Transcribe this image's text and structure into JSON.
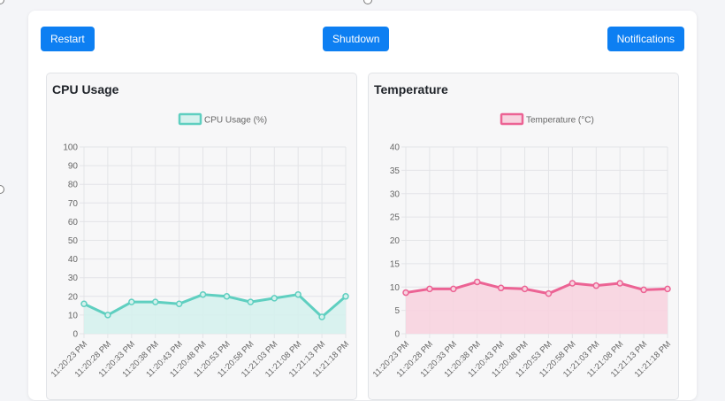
{
  "toolbar": {
    "restart_label": "Restart",
    "shutdown_label": "Shutdown",
    "notifications_label": "Notifications"
  },
  "colors": {
    "button": "#0d7ff2",
    "cpu_line": "#5fcfc0",
    "cpu_fill": "#d5f1ed",
    "temp_line": "#ec6394",
    "temp_fill": "#f7d3df"
  },
  "panels": {
    "cpu": {
      "title": "CPU Usage"
    },
    "temp": {
      "title": "Temperature"
    }
  },
  "chart_data": [
    {
      "type": "area",
      "title": "CPU Usage",
      "categories": [
        "11:20:23 PM",
        "11:20:28 PM",
        "11:20:33 PM",
        "11:20:38 PM",
        "11:20:43 PM",
        "11:20:48 PM",
        "11:20:53 PM",
        "11:20:58 PM",
        "11:21:03 PM",
        "11:21:08 PM",
        "11:21:13 PM",
        "11:21:18 PM"
      ],
      "series": [
        {
          "name": "CPU Usage (%)",
          "values": [
            16,
            10,
            17,
            17,
            16,
            21,
            20,
            17,
            19,
            21,
            9,
            20
          ]
        }
      ],
      "ylim": [
        0,
        100
      ],
      "yticks": [
        0,
        10,
        20,
        30,
        40,
        50,
        60,
        70,
        80,
        90,
        100
      ],
      "grid": true,
      "legend": "top-center"
    },
    {
      "type": "area",
      "title": "Temperature",
      "categories": [
        "11:20:23 PM",
        "11:20:28 PM",
        "11:20:33 PM",
        "11:20:38 PM",
        "11:20:43 PM",
        "11:20:48 PM",
        "11:20:53 PM",
        "11:20:58 PM",
        "11:21:03 PM",
        "11:21:08 PM",
        "11:21:13 PM",
        "11:21:18 PM"
      ],
      "series": [
        {
          "name": "Temperature (°C)",
          "values": [
            8.8,
            9.6,
            9.6,
            11.1,
            9.8,
            9.6,
            8.6,
            10.8,
            10.3,
            10.8,
            9.4,
            9.6
          ]
        }
      ],
      "ylim": [
        0,
        40
      ],
      "yticks": [
        0,
        5,
        10,
        15,
        20,
        25,
        30,
        35,
        40
      ],
      "grid": true,
      "legend": "top-center"
    }
  ]
}
